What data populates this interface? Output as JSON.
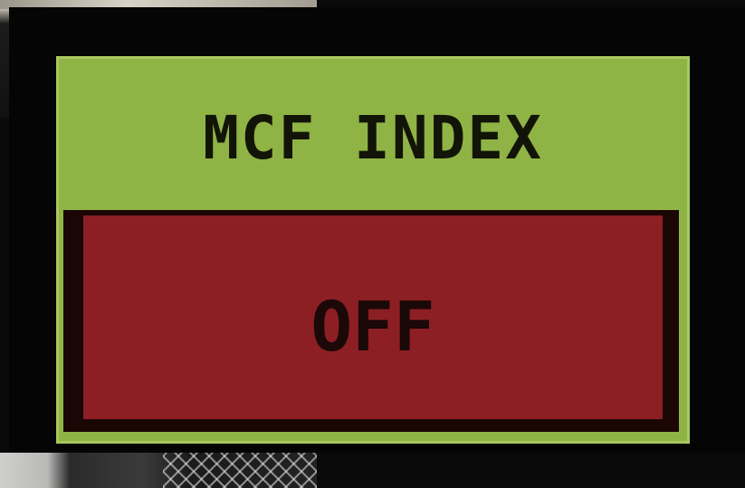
{
  "panel": {
    "title": "MCF INDEX",
    "status_label": "OFF",
    "colors": {
      "panel_background": "#8fb345",
      "status_button": "#8c1f23",
      "text": "#121408",
      "bezel": "#050505"
    }
  }
}
